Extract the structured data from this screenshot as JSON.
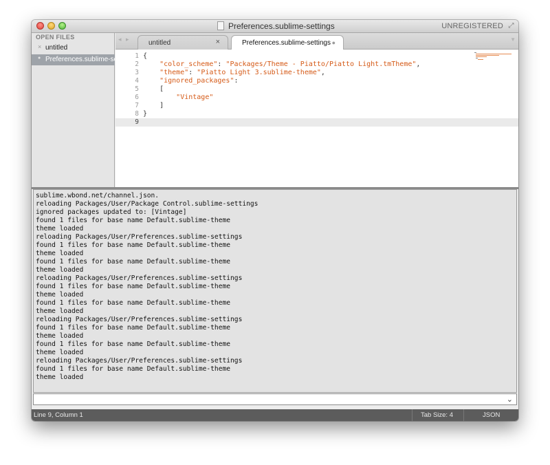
{
  "window": {
    "title": "Preferences.sublime-settings",
    "unregistered": "UNREGISTERED"
  },
  "sidebar": {
    "heading": "OPEN FILES",
    "files": [
      {
        "label": "untitled",
        "marker": "×"
      },
      {
        "label": "Preferences.sublime-settings",
        "marker": "●"
      }
    ]
  },
  "tabs": [
    {
      "label": "untitled",
      "close": "×"
    },
    {
      "label": "Preferences.sublime-settings",
      "close": "●"
    }
  ],
  "editor": {
    "line_numbers": [
      "1",
      "2",
      "3",
      "4",
      "5",
      "6",
      "7",
      "8",
      "9"
    ],
    "lines": [
      "{",
      "    \"color_scheme\": \"Packages/Theme - Piatto/Piatto Light.tmTheme\",",
      "    \"theme\": \"Piatto Light 3.sublime-theme\",",
      "    \"ignored_packages\":",
      "    [",
      "        \"Vintage\"",
      "    ]",
      "}",
      ""
    ]
  },
  "console": {
    "lines": [
      "sublime.wbond.net/channel.json.",
      "reloading Packages/User/Package Control.sublime-settings",
      "ignored packages updated to: [Vintage]",
      "found 1 files for base name Default.sublime-theme",
      "theme loaded",
      "reloading Packages/User/Preferences.sublime-settings",
      "found 1 files for base name Default.sublime-theme",
      "theme loaded",
      "found 1 files for base name Default.sublime-theme",
      "theme loaded",
      "reloading Packages/User/Preferences.sublime-settings",
      "found 1 files for base name Default.sublime-theme",
      "theme loaded",
      "found 1 files for base name Default.sublime-theme",
      "theme loaded",
      "reloading Packages/User/Preferences.sublime-settings",
      "found 1 files for base name Default.sublime-theme",
      "theme loaded",
      "found 1 files for base name Default.sublime-theme",
      "theme loaded",
      "reloading Packages/User/Preferences.sublime-settings",
      "found 1 files for base name Default.sublime-theme",
      "theme loaded"
    ],
    "input_value": ""
  },
  "statusbar": {
    "position": "Line 9, Column 1",
    "tab_size": "Tab Size: 4",
    "syntax": "JSON"
  },
  "colors": {
    "string": "#d55a17",
    "statusbar_bg": "#5c5c5c",
    "selected_file_bg": "#9ea3a9"
  }
}
